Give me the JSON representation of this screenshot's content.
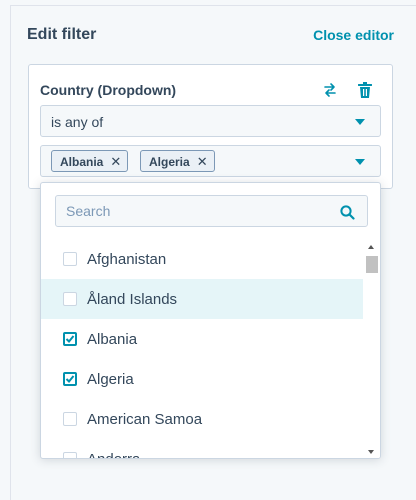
{
  "header": {
    "title": "Edit filter",
    "close_label": "Close editor"
  },
  "filter": {
    "property_label": "Country (Dropdown)",
    "operator": "is any of",
    "selected_tags": [
      "Albania",
      "Algeria"
    ]
  },
  "dropdown": {
    "search_placeholder": "Search",
    "options": [
      {
        "label": "Afghanistan",
        "checked": false
      },
      {
        "label": "Åland Islands",
        "checked": false
      },
      {
        "label": "Albania",
        "checked": true
      },
      {
        "label": "Algeria",
        "checked": true
      },
      {
        "label": "American Samoa",
        "checked": false
      },
      {
        "label": "Andorra",
        "checked": false
      }
    ],
    "hovered_option": "Åland Islands"
  },
  "colors": {
    "accent": "#0091ae",
    "text": "#33475b",
    "border": "#cbd6e2",
    "hover": "#e5f5f8"
  },
  "icons": {
    "swap": "swap-arrows-icon",
    "delete": "trash-icon",
    "search": "search-icon",
    "caret": "caret-down-icon"
  }
}
